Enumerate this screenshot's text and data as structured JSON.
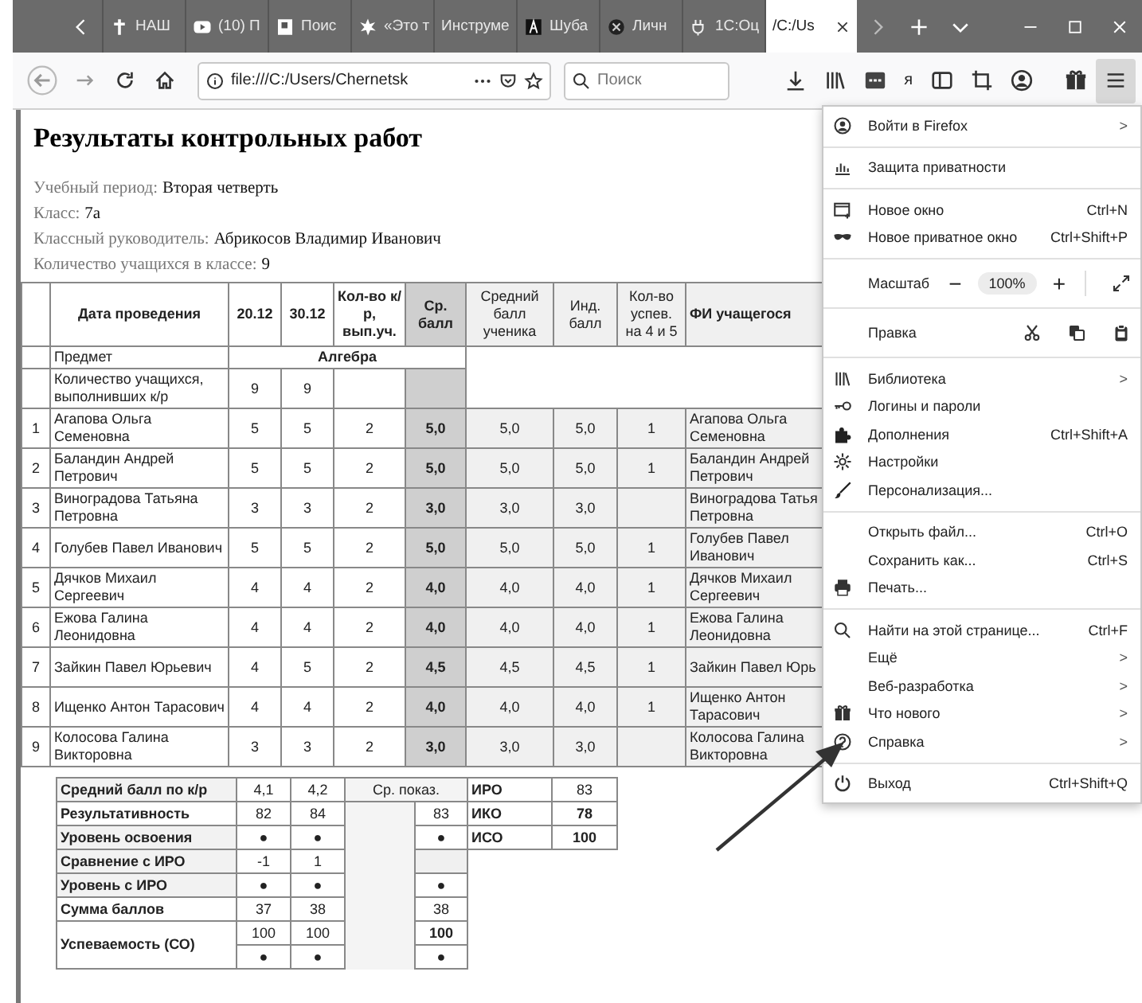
{
  "tabs": [
    {
      "label": "НАШ",
      "selected": false
    },
    {
      "label": "(10) П",
      "selected": false
    },
    {
      "label": "Поис",
      "selected": false
    },
    {
      "label": "«Это т",
      "selected": false
    },
    {
      "label": "Инструме",
      "selected": false
    },
    {
      "label": "Шуба",
      "selected": false
    },
    {
      "label": "Личн",
      "selected": false
    },
    {
      "label": "1С:Оц",
      "selected": false
    },
    {
      "label": "/C:/Us",
      "selected": true
    }
  ],
  "toolbar": {
    "url": "file:///C:/Users/Chernetsk",
    "search": {
      "placeholder": "Поиск"
    },
    "extension_letter": "я"
  },
  "page": {
    "title": "Результаты контрольных работ",
    "info": [
      {
        "label": "Учебный период:",
        "value": "Вторая четверть"
      },
      {
        "label": "Класс:",
        "value": "7а"
      },
      {
        "label": "Классный руководитель:",
        "value": "Абрикосов Владимир Иванович"
      },
      {
        "label": "Количество учащихся в классе:",
        "value": "9"
      }
    ],
    "table": {
      "columns": [
        "Дата проведения",
        "20.12",
        "30.12",
        "Кол-во к/р, вып.уч.",
        "Ср. балл",
        "Средний балл ученика",
        "Инд. балл",
        "Кол-во успев. на 4 и 5",
        "ФИ учащегося"
      ],
      "subject_row": {
        "label": "Предмет",
        "value": "Алгебра"
      },
      "count_row": {
        "label": "Количество учащихся, выполнивших к/р",
        "values": [
          "9",
          "9"
        ]
      },
      "rows": [
        {
          "n": "1",
          "name": "Агапова Ольга Семеновна",
          "scores": [
            "5",
            "5"
          ],
          "works": "2",
          "avg": "5,0",
          "student_avg": "5,0",
          "ind": "5,0",
          "good": "1",
          "fi": "Агапова Ольга Семеновна"
        },
        {
          "n": "2",
          "name": "Баландин Андрей Петрович",
          "scores": [
            "5",
            "5"
          ],
          "works": "2",
          "avg": "5,0",
          "student_avg": "5,0",
          "ind": "5,0",
          "good": "1",
          "fi": "Баландин Андрей Петрович"
        },
        {
          "n": "3",
          "name": "Виноградова Татьяна Петровна",
          "scores": [
            "3",
            "3"
          ],
          "works": "2",
          "avg": "3,0",
          "student_avg": "3,0",
          "ind": "3,0",
          "fi": "Виноградова Татья Петровна"
        },
        {
          "n": "4",
          "name": "Голубев Павел Иванович",
          "scores": [
            "5",
            "5"
          ],
          "works": "2",
          "avg": "5,0",
          "student_avg": "5,0",
          "ind": "5,0",
          "good": "1",
          "fi": "Голубев Павел Иванович"
        },
        {
          "n": "5",
          "name": "Дячков Михаил Сергеевич",
          "scores": [
            "4",
            "4"
          ],
          "works": "2",
          "avg": "4,0",
          "student_avg": "4,0",
          "ind": "4,0",
          "good": "1",
          "fi": "Дячков Михаил Сергеевич"
        },
        {
          "n": "6",
          "name": "Ежова Галина Леонидовна",
          "scores": [
            "4",
            "4"
          ],
          "works": "2",
          "avg": "4,0",
          "student_avg": "4,0",
          "ind": "4,0",
          "good": "1",
          "fi": "Ежова Галина Леонидовна"
        },
        {
          "n": "7",
          "name": "Зайкин Павел Юрьевич",
          "scores": [
            "4",
            "5"
          ],
          "works": "2",
          "avg": "4,5",
          "student_avg": "4,5",
          "ind": "4,5",
          "good": "1",
          "fi": "Зайкин Павел Юрь"
        },
        {
          "n": "8",
          "name": "Ищенко Антон Тарасович",
          "scores": [
            "4",
            "4"
          ],
          "works": "2",
          "avg": "4,0",
          "student_avg": "4,0",
          "ind": "4,0",
          "good": "1",
          "fi": "Ищенко Антон Тарасович"
        },
        {
          "n": "9",
          "name": "Колосова Галина Викторовна",
          "scores": [
            "3",
            "3"
          ],
          "works": "2",
          "avg": "3,0",
          "student_avg": "3,0",
          "ind": "3,0",
          "fi": "Колосова Галина Викторовна"
        }
      ]
    },
    "summary": {
      "mid_header": "Ср. показ.",
      "rows": [
        {
          "label": "Средний балл по к/р",
          "values": [
            "4,1",
            "4,2"
          ],
          "index": {
            "label": "ИРО",
            "value": "83"
          }
        },
        {
          "label": "Результативность",
          "values": [
            "82",
            "84"
          ],
          "total": "83",
          "index": {
            "label": "ИКО",
            "value": "78"
          }
        },
        {
          "label": "Уровень освоения",
          "values": [
            "●",
            "●"
          ],
          "total": "●",
          "index": {
            "label": "ИСО",
            "value": "100"
          }
        },
        {
          "label": "Сравнение с ИРО",
          "values": [
            "-1",
            "1"
          ]
        },
        {
          "label": "Уровень с ИРО",
          "values": [
            "●",
            "●"
          ],
          "total": "●"
        },
        {
          "label": "Сумма баллов",
          "values": [
            "37",
            "38"
          ],
          "total": "38"
        },
        {
          "label": "Успеваемость (СО)",
          "values": [
            "100",
            "100"
          ],
          "total": "100",
          "second": {
            "values": [
              "●",
              "●"
            ],
            "total": "●"
          }
        }
      ]
    }
  },
  "menu": {
    "groups": [
      {
        "kind": "list",
        "items": [
          {
            "label": "Войти в Firefox",
            "arrow": ">"
          }
        ]
      },
      {
        "kind": "list",
        "items": [
          {
            "label": "Защита приватности"
          }
        ]
      },
      {
        "kind": "list",
        "items": [
          {
            "label": "Новое окно",
            "shortcut": "Ctrl+N"
          },
          {
            "label": "Новое приватное окно",
            "shortcut": "Ctrl+Shift+P"
          }
        ]
      },
      {
        "kind": "zoom",
        "label": "Масштаб",
        "minus": "−",
        "value": "100%",
        "plus": "+"
      },
      {
        "kind": "edit",
        "label": "Правка"
      },
      {
        "kind": "list",
        "items": [
          {
            "label": "Библиотека",
            "arrow": ">"
          },
          {
            "label": "Логины и пароли"
          },
          {
            "label": "Дополнения",
            "shortcut": "Ctrl+Shift+A"
          },
          {
            "label": "Настройки"
          },
          {
            "label": "Персонализация..."
          }
        ]
      },
      {
        "kind": "list",
        "items": [
          {
            "label": "Открыть файл...",
            "shortcut": "Ctrl+O"
          },
          {
            "label": "Сохранить как...",
            "shortcut": "Ctrl+S"
          },
          {
            "label": "Печать..."
          }
        ]
      },
      {
        "kind": "list",
        "items": [
          {
            "label": "Найти на этой странице...",
            "shortcut": "Ctrl+F"
          },
          {
            "label": "Ещё",
            "arrow": ">"
          },
          {
            "label": "Веб-разработка",
            "arrow": ">"
          },
          {
            "label": "Что нового",
            "arrow": ">"
          },
          {
            "label": "Справка",
            "arrow": ">"
          }
        ]
      },
      {
        "kind": "list",
        "items": [
          {
            "label": "Выход",
            "shortcut": "Ctrl+Shift+Q"
          }
        ]
      }
    ]
  }
}
